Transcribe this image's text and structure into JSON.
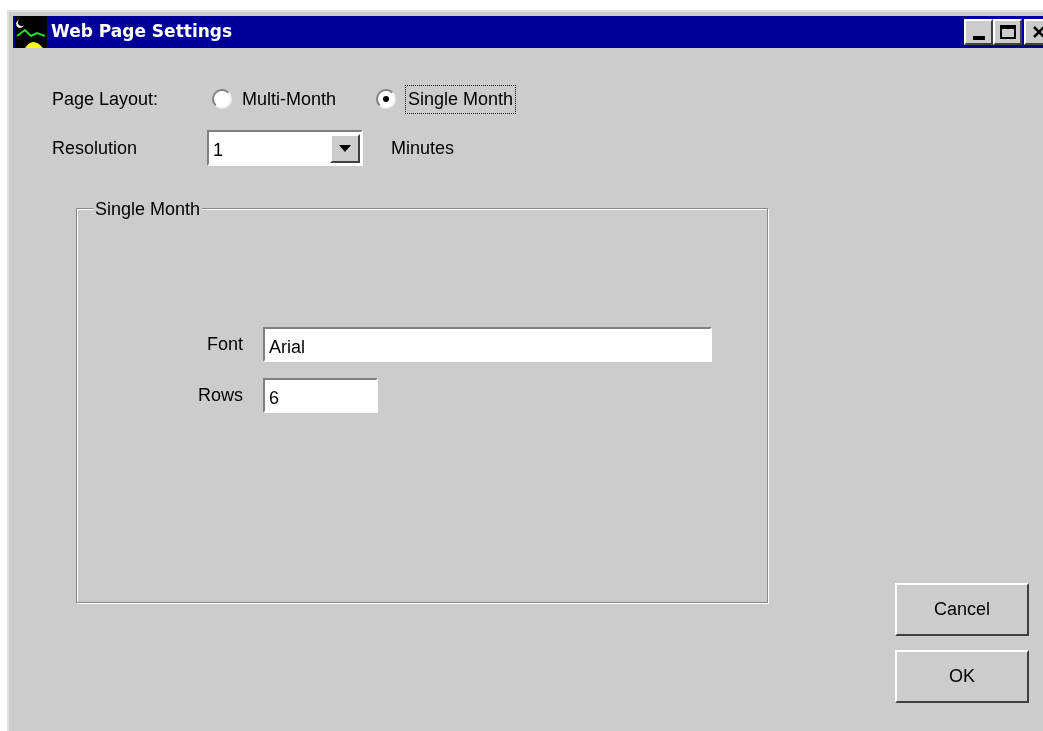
{
  "window": {
    "title": "Web Page Settings"
  },
  "page_layout": {
    "label": "Page Layout:",
    "options": [
      {
        "label": "Multi-Month",
        "selected": false
      },
      {
        "label": "Single Month",
        "selected": true
      }
    ]
  },
  "resolution": {
    "label": "Resolution",
    "value": "1",
    "unit": "Minutes"
  },
  "group": {
    "title": "Single Month",
    "fields": [
      {
        "label": "Font",
        "value": "Arial"
      },
      {
        "label": "Rows",
        "value": "6"
      }
    ]
  },
  "buttons": [
    {
      "label": "Cancel"
    },
    {
      "label": "OK"
    }
  ]
}
